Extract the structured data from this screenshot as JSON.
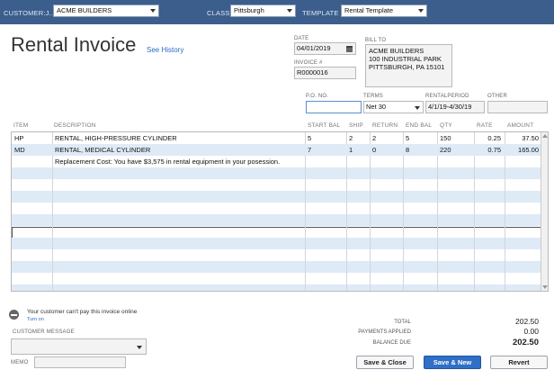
{
  "header": {
    "customer_label": "CUSTOMER:J...",
    "customer_value": "ACME BUILDERS",
    "class_label": "CLASS",
    "class_value": "Pittsburgh",
    "template_label": "TEMPLATE",
    "template_value": "Rental Template"
  },
  "form": {
    "title": "Rental Invoice",
    "see_history": "See History",
    "date_label": "DATE",
    "date_value": "04/01/2019",
    "invoice_label": "INVOICE #",
    "invoice_value": "R0000016",
    "bill_to_label": "BILL TO",
    "bill_to_lines": [
      "ACME BUILDERS",
      "100 INDUSTRIAL PARK",
      "PITTSBURGH, PA 15101"
    ],
    "po_label": "P.O. NO.",
    "po_value": "",
    "terms_label": "TERMS",
    "terms_value": "Net 30",
    "rental_period_label": "RENTALPERIOD",
    "rental_period_value": "4/1/19-4/30/19",
    "other_label": "OTHER",
    "other_value": ""
  },
  "table": {
    "columns": [
      "ITEM",
      "DESCRIPTION",
      "START BAL",
      "SHIP",
      "RETURN",
      "END BAL",
      "QTY",
      "RATE",
      "AMOUNT"
    ],
    "rows": [
      {
        "item": "HP",
        "description": "RENTAL, HIGH-PRESSURE CYLINDER",
        "start_bal": "5",
        "ship": "2",
        "return": "2",
        "end_bal": "5",
        "qty": "150",
        "rate": "0.25",
        "amount": "37.50"
      },
      {
        "item": "MD",
        "description": "RENTAL, MEDICAL CYLINDER",
        "start_bal": "7",
        "ship": "1",
        "return": "0",
        "end_bal": "8",
        "qty": "220",
        "rate": "0.75",
        "amount": "165.00"
      },
      {
        "item": "",
        "description": "Replacement Cost: You have $3,575 in rental equipment in your posession.",
        "start_bal": "",
        "ship": "",
        "return": "",
        "end_bal": "",
        "qty": "",
        "rate": "",
        "amount": ""
      }
    ]
  },
  "footer": {
    "payment_notice": "Your customer can't pay this invoice online",
    "turn_on": "Turn on",
    "customer_message_label": "CUSTOMER MESSAGE",
    "memo_label": "MEMO",
    "total_label": "TOTAL",
    "total_value": "202.50",
    "payments_label": "PAYMENTS APPLIED",
    "payments_value": "0.00",
    "balance_label": "BALANCE DUE",
    "balance_value": "202.50",
    "save_close": "Save & Close",
    "save_new": "Save & New",
    "revert": "Revert"
  },
  "colors": {
    "header_bar": "#3b5e8c",
    "alt_row": "#dfeaf7",
    "primary_button": "#2f6fc6"
  }
}
